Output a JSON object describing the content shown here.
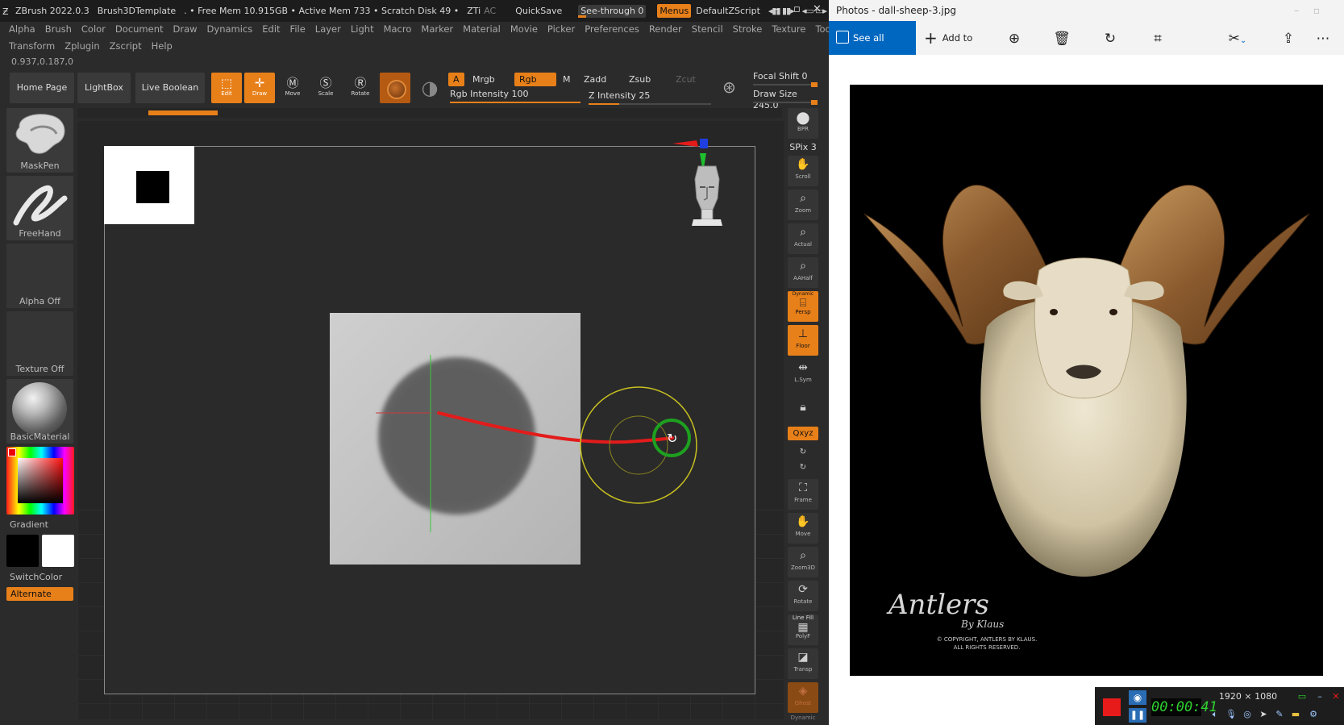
{
  "zbrush": {
    "title": {
      "app": "ZBrush 2022.0.3",
      "template": "Brush3DTemplate",
      "mem": ". • Free Mem 10.915GB • Active Mem 733 • Scratch Disk 49 •",
      "zti": "ZTi",
      "ac": "AC",
      "quicksave": "QuickSave",
      "seethrough": "See-through",
      "seethrough_value": "0",
      "menus": "Menus",
      "defaultzscript": "DefaultZScript"
    },
    "menu_row1": [
      "Alpha",
      "Brush",
      "Color",
      "Document",
      "Draw",
      "Dynamics",
      "Edit",
      "File",
      "Layer",
      "Light",
      "Macro",
      "Marker",
      "Material",
      "Movie",
      "Picker",
      "Preferences",
      "Render",
      "Stencil",
      "Stroke",
      "Texture",
      "Tool"
    ],
    "menu_row2": [
      "Transform",
      "Zplugin",
      "Zscript",
      "Help"
    ],
    "coords": "0.937,0.187,0",
    "shelf": {
      "home": "Home Page",
      "lightbox": "LightBox",
      "liveboolean": "Live Boolean",
      "edit": "Edit",
      "draw": "Draw",
      "move": "Move",
      "scale": "Scale",
      "rotate": "Rotate",
      "a": "A",
      "mrgb": "Mrgb",
      "rgb": "Rgb",
      "m": "M",
      "zadd": "Zadd",
      "zsub": "Zsub",
      "zcut": "Zcut",
      "rgb_intensity": "Rgb Intensity 100",
      "z_intensity": "Z Intensity 25",
      "focal_shift": "Focal Shift 0",
      "draw_size": "Draw Size 245.0",
      "rgb_intensity_value": 100,
      "z_intensity_value": 25
    },
    "left_panel": {
      "brush": "MaskPen",
      "stroke": "FreeHand",
      "alpha": "Alpha Off",
      "texture": "Texture Off",
      "material": "BasicMaterial",
      "gradient": "Gradient",
      "switchcolor": "SwitchColor",
      "alternate": "Alternate",
      "color_main": "#000000",
      "color_secondary": "#ffffff"
    },
    "right_bar": {
      "bpr": "BPR",
      "spix": "SPix 3",
      "scroll": "Scroll",
      "zoom": "Zoom",
      "actual": "Actual",
      "aahalf": "AAHalf",
      "dynamic": "Dynamic",
      "persp": "Persp",
      "floor": "Floor",
      "lsym": "L.Sym",
      "xyz": "Qxyz",
      "frame": "Frame",
      "move": "Move",
      "zoom3d": "Zoom3D",
      "rotate": "Rotate",
      "linefill": "Line Fill",
      "polyf": "PolyF",
      "transp": "Transp",
      "ghost": "Ghost",
      "dynamic_bottom": "Dynamic"
    },
    "accent": "#e8801a"
  },
  "photos": {
    "title": "Photos - dall-sheep-3.jpg",
    "see_all": "See all photos",
    "add_to": "Add to",
    "icons": [
      "zoom-in-icon",
      "delete-icon",
      "rotate-icon",
      "crop-icon",
      "edit-icon",
      "share-icon",
      "more-icon"
    ],
    "watermark": {
      "brand": "Antlers",
      "by": "By Klaus",
      "copyright": "© COPYRIGHT, ANTLERS BY KLAUS.",
      "rights": "ALL RIGHTS RESERVED."
    }
  },
  "recorder": {
    "time": "00:00:41",
    "resolution": "1920 × 1080"
  }
}
